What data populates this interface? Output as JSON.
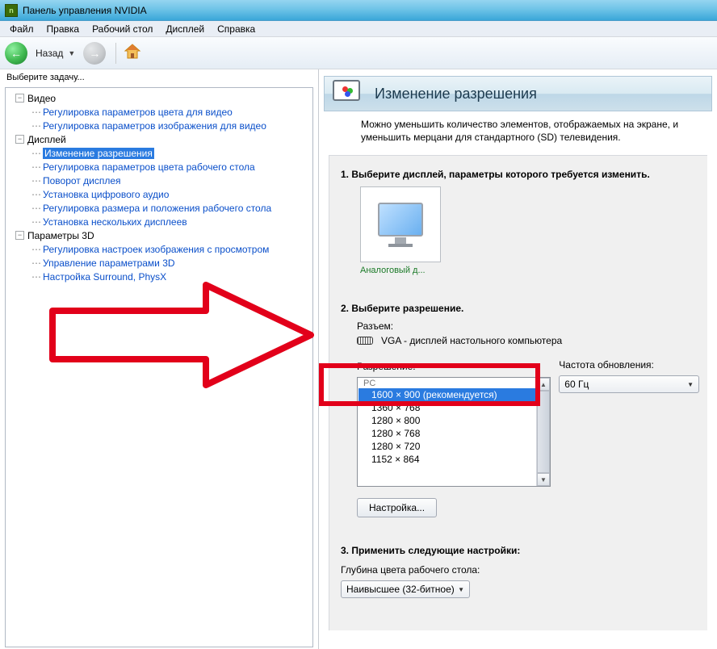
{
  "window": {
    "title": "Панель управления NVIDIA"
  },
  "menu": {
    "file": "Файл",
    "edit": "Правка",
    "desktop": "Рабочий стол",
    "display": "Дисплей",
    "help": "Справка"
  },
  "toolbar": {
    "back": "Назад"
  },
  "task_label": "Выберите задачу...",
  "tree": {
    "video": "Видео",
    "video_items": [
      "Регулировка параметров цвета для видео",
      "Регулировка параметров изображения для видео"
    ],
    "display": "Дисплей",
    "display_items": [
      "Изменение разрешения",
      "Регулировка параметров цвета рабочего стола",
      "Поворот дисплея",
      "Установка цифрового аудио",
      "Регулировка размера и положения рабочего стола",
      "Установка нескольких дисплеев"
    ],
    "params3d": "Параметры 3D",
    "params3d_items": [
      "Регулировка настроек изображения с просмотром",
      "Управление параметрами 3D",
      "Настройка Surround, PhysX"
    ]
  },
  "page": {
    "title": "Изменение разрешения",
    "description": "Можно уменьшить количество элементов, отображаемых на экране, и уменьшить мерцани для стандартного (SD) телевидения.",
    "step1": "1. Выберите дисплей, параметры которого требуется изменить.",
    "display_name": "Аналоговый д...",
    "step2": "2. Выберите разрешение.",
    "connector_label": "Разъем:",
    "connector_value": "VGA - дисплей настольного компьютера",
    "resolution_label": "Разрешение:",
    "res_group": "PC",
    "resolutions": [
      "1600 × 900 (рекомендуется)",
      "1360 × 768",
      "1280 × 800",
      "1280 × 768",
      "1280 × 720",
      "1152 × 864"
    ],
    "refresh_label": "Частота обновления:",
    "refresh_value": "60 Гц",
    "customize_btn": "Настройка...",
    "step3": "3. Применить следующие настройки:",
    "color_depth_label": "Глубина цвета рабочего стола:",
    "color_depth_value": "Наивысшее (32-битное)"
  }
}
